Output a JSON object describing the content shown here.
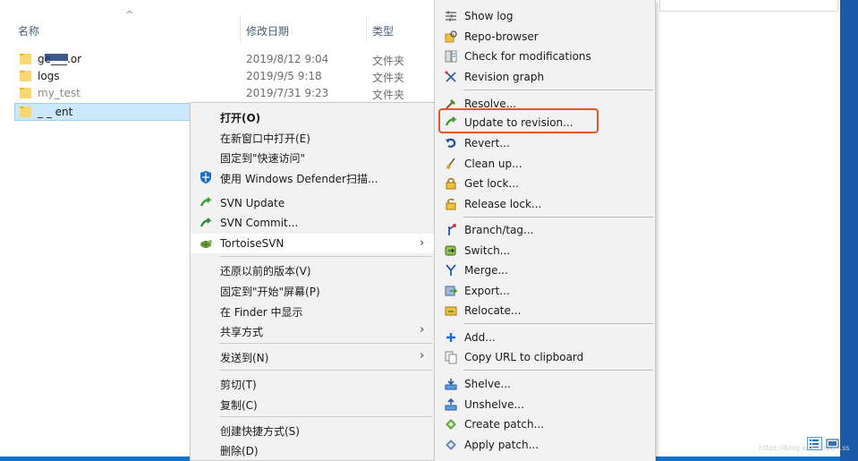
{
  "explorer": {
    "headers": {
      "name": "名称",
      "date": "修改日期",
      "type": "类型"
    },
    "files": [
      {
        "name": "ge___.or",
        "date": "2019/8/12 9:04",
        "type": "文件夹"
      },
      {
        "name": "logs",
        "date": "2019/9/5 9:18",
        "type": "文件夹"
      },
      {
        "name": "my_test",
        "date": "2019/7/31 9:23",
        "type": "文件夹"
      },
      {
        "name": "_ _ ent",
        "date": "",
        "type": ""
      }
    ],
    "watermark": "https://blog.csdn.net/...ss",
    "colors": {
      "selection": "#cce8ff",
      "folder": "#f8d775",
      "accent": "#1673c8"
    }
  },
  "context_menu": {
    "items": [
      {
        "label": "打开(O)",
        "bold": true,
        "icon": ""
      },
      {
        "label": "在新窗口中打开(E)",
        "icon": ""
      },
      {
        "label": "固定到\"快速访问\"",
        "icon": ""
      },
      {
        "label": "使用 Windows Defender扫描...",
        "icon": "defender-shield-icon"
      },
      {
        "label": "SVN Update",
        "icon": "svn-update-icon"
      },
      {
        "label": "SVN Commit...",
        "icon": "svn-commit-icon"
      },
      {
        "label": "TortoiseSVN",
        "icon": "tortoisesvn-icon",
        "submenu": true
      },
      {
        "label": "还原以前的版本(V)",
        "icon": ""
      },
      {
        "label": "固定到\"开始\"屏幕(P)",
        "icon": ""
      },
      {
        "label": "在 Finder 中显示",
        "icon": ""
      },
      {
        "label": "共享方式",
        "icon": "",
        "submenu": true
      },
      {
        "label": "发送到(N)",
        "icon": "",
        "submenu": true
      },
      {
        "label": "剪切(T)",
        "icon": ""
      },
      {
        "label": "复制(C)",
        "icon": ""
      },
      {
        "label": "创建快捷方式(S)",
        "icon": ""
      },
      {
        "label": "删除(D)",
        "icon": ""
      }
    ]
  },
  "svn_submenu": {
    "items": [
      {
        "label": "Show log",
        "icon": "show-log-icon"
      },
      {
        "label": "Repo-browser",
        "icon": "repo-browser-icon"
      },
      {
        "label": "Check for modifications",
        "icon": "check-modifications-icon"
      },
      {
        "label": "Revision graph",
        "icon": "revision-graph-icon"
      },
      {
        "label": "Resolve...",
        "icon": "resolve-icon"
      },
      {
        "label": "Update to revision...",
        "icon": "update-to-revision-icon",
        "highlighted": true
      },
      {
        "label": "Revert...",
        "icon": "revert-icon"
      },
      {
        "label": "Clean up...",
        "icon": "clean-up-icon"
      },
      {
        "label": "Get lock...",
        "icon": "get-lock-icon"
      },
      {
        "label": "Release lock...",
        "icon": "release-lock-icon"
      },
      {
        "label": "Branch/tag...",
        "icon": "branch-tag-icon"
      },
      {
        "label": "Switch...",
        "icon": "switch-icon"
      },
      {
        "label": "Merge...",
        "icon": "merge-icon"
      },
      {
        "label": "Export...",
        "icon": "export-icon"
      },
      {
        "label": "Relocate...",
        "icon": "relocate-icon"
      },
      {
        "label": "Add...",
        "icon": "add-icon"
      },
      {
        "label": "Copy URL to clipboard",
        "icon": "copy-url-icon"
      },
      {
        "label": "Shelve...",
        "icon": "shelve-icon"
      },
      {
        "label": "Unshelve...",
        "icon": "unshelve-icon"
      },
      {
        "label": "Create patch...",
        "icon": "create-patch-icon"
      },
      {
        "label": "Apply patch...",
        "icon": "apply-patch-icon"
      }
    ],
    "highlight_color": "#e2572b"
  }
}
